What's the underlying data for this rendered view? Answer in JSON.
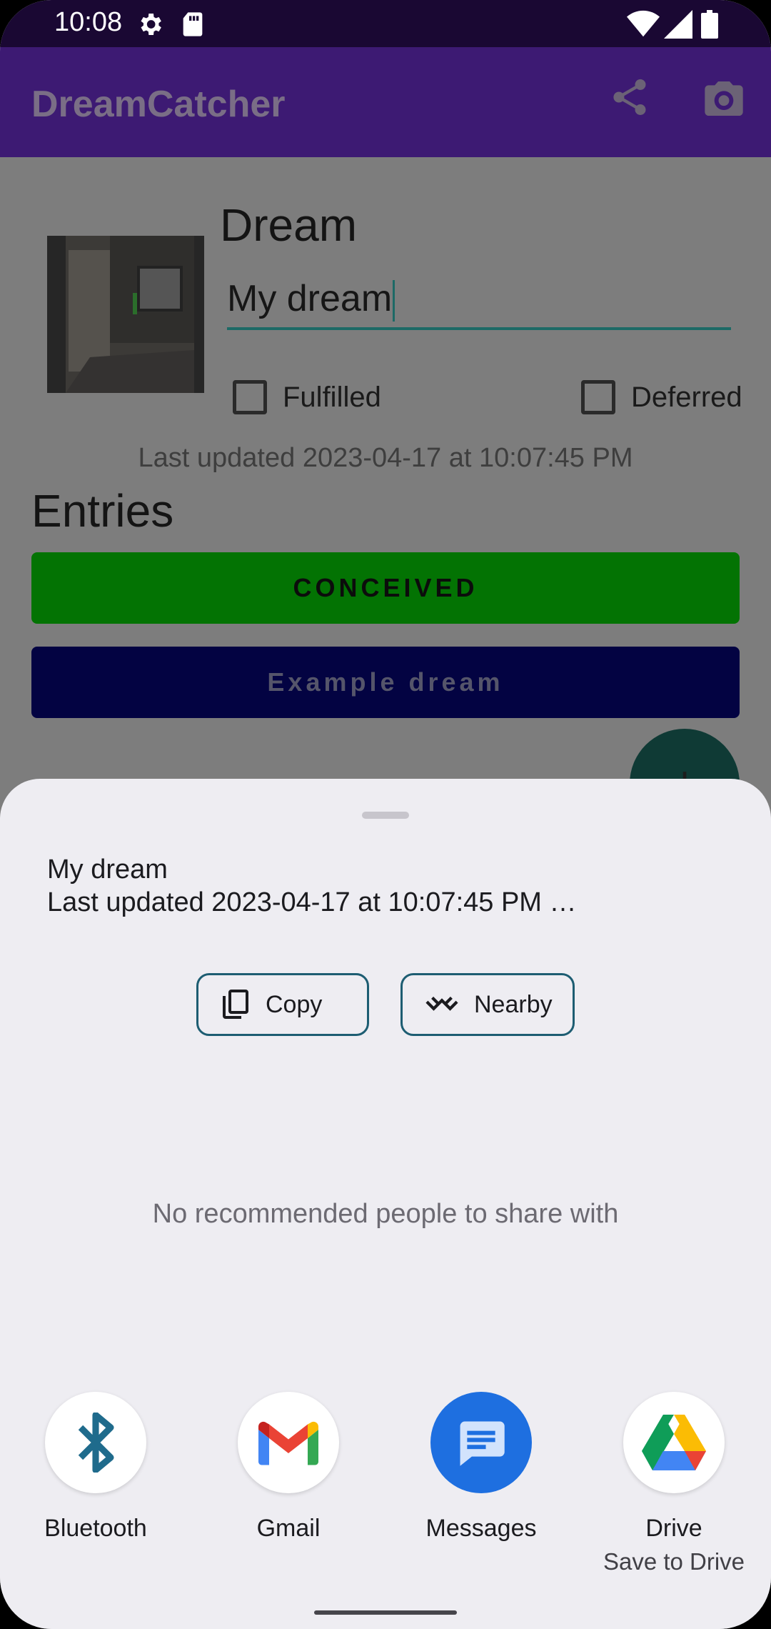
{
  "status_bar": {
    "time": "10:08",
    "icons": [
      "gear-icon",
      "sd-card-icon",
      "wifi-icon",
      "signal-icon",
      "battery-icon"
    ]
  },
  "app_bar": {
    "title": "DreamCatcher",
    "actions": [
      "share-icon",
      "camera-icon"
    ]
  },
  "dream": {
    "heading": "Dream",
    "title_value": "My dream",
    "fulfilled_label": "Fulfilled",
    "deferred_label": "Deferred",
    "last_updated": "Last updated 2023-04-17 at 10:07:45 PM"
  },
  "entries": {
    "heading": "Entries",
    "items": [
      {
        "label": "CONCEIVED",
        "color": "#00ff00"
      },
      {
        "label": "Example dream",
        "color": "#000099"
      }
    ],
    "fab_icon": "plus-icon"
  },
  "share_sheet": {
    "preview_title": "My dream",
    "preview_text": "Last updated 2023-04-17 at 10:07:45 PM …",
    "chips": {
      "copy": "Copy",
      "nearby": "Nearby"
    },
    "no_recommendations": "No recommended people to share with",
    "targets": [
      {
        "label": "Bluetooth",
        "sublabel": "",
        "icon": "bluetooth-icon"
      },
      {
        "label": "Gmail",
        "sublabel": "",
        "icon": "gmail-icon"
      },
      {
        "label": "Messages",
        "sublabel": "",
        "icon": "messages-icon"
      },
      {
        "label": "Drive",
        "sublabel": "Save to Drive",
        "icon": "drive-icon"
      }
    ]
  },
  "colors": {
    "primary": "#6200ee",
    "scrim": "#7d7d7d",
    "sheet_bg": "#eeedf2",
    "chip_outline": "#1d5d72"
  }
}
